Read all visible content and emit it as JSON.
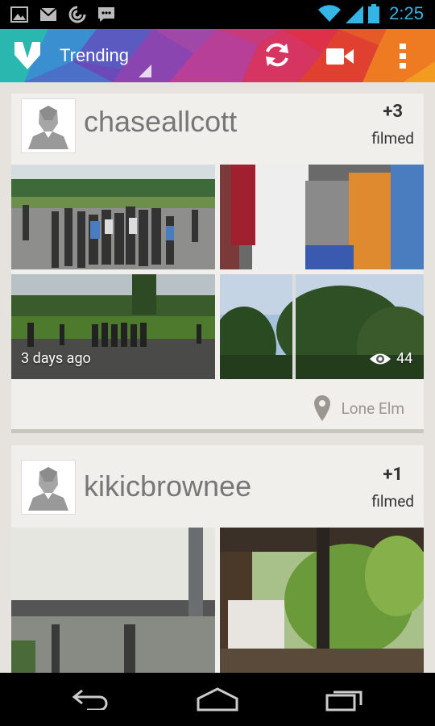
{
  "status_bar": {
    "time": "2:25",
    "left_icons": [
      "gallery-icon",
      "gmail-icon",
      "sync-icon",
      "chat-icon"
    ],
    "right_icons": [
      "wifi-icon",
      "signal-icon",
      "battery-icon"
    ]
  },
  "action_bar": {
    "title": "Trending",
    "actions": [
      "refresh-icon",
      "video-camera-icon",
      "overflow-menu-icon"
    ]
  },
  "posts": [
    {
      "username": "chaseallcott",
      "plus_count": "+3",
      "filmed_label": "filmed",
      "time_ago": "3 days ago",
      "views": "44",
      "location": "Lone Elm"
    },
    {
      "username": "kikicbrownee",
      "plus_count": "+1",
      "filmed_label": "filmed"
    }
  ],
  "nav_bar": {
    "buttons": [
      "back-icon",
      "home-icon",
      "recents-icon"
    ]
  }
}
